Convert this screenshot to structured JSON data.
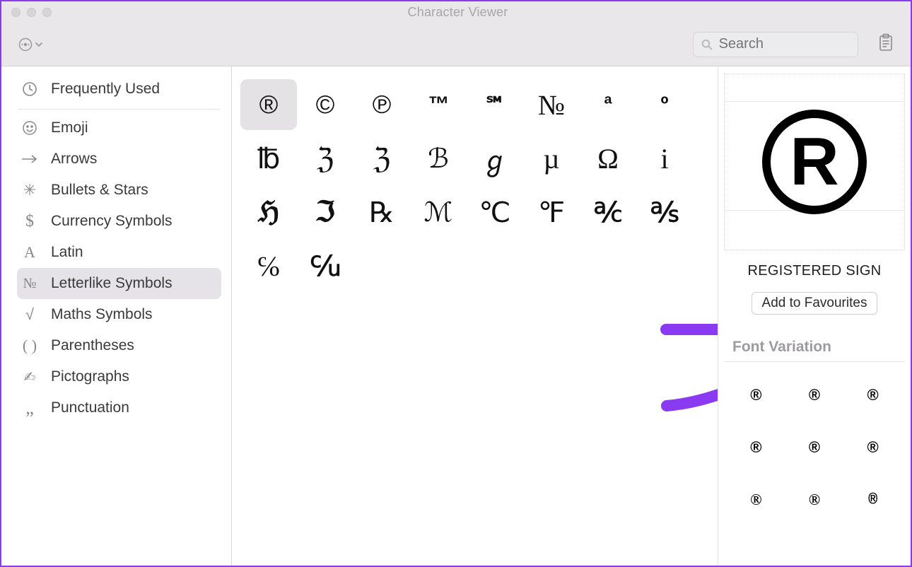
{
  "window": {
    "title": "Character Viewer"
  },
  "search": {
    "placeholder": "Search"
  },
  "sidebar": {
    "items": [
      {
        "label": "Frequently Used",
        "icon": "clock-icon"
      },
      {
        "label": "Emoji",
        "icon": "emoji-icon"
      },
      {
        "label": "Arrows",
        "icon": "arrow-right-icon"
      },
      {
        "label": "Bullets & Stars",
        "icon": "sparkle-icon"
      },
      {
        "label": "Currency Symbols",
        "icon": "dollar-icon"
      },
      {
        "label": "Latin",
        "icon": "letter-a-icon"
      },
      {
        "label": "Letterlike Symbols",
        "icon": "numero-icon",
        "selected": true
      },
      {
        "label": "Maths Symbols",
        "icon": "sqrt-icon"
      },
      {
        "label": "Parentheses",
        "icon": "parens-icon"
      },
      {
        "label": "Pictographs",
        "icon": "writing-hand-icon"
      },
      {
        "label": "Punctuation",
        "icon": "comma-icon"
      }
    ]
  },
  "grid": {
    "selected_index": 0,
    "chars": [
      "®",
      "©",
      "℗",
      "™",
      "℠",
      "№",
      "ª",
      "º",
      "℔",
      "ℨ",
      "ℨ",
      "ℬ",
      "ℊ",
      "µ",
      "Ω",
      "i",
      "ℌ",
      "ℑ",
      "℞",
      "ℳ",
      "℃",
      "℉",
      "℀",
      "℁",
      "℅",
      "℆"
    ]
  },
  "inspector": {
    "glyph": "®",
    "name": "REGISTERED SIGN",
    "add_fav_label": "Add to Favourites",
    "variation_header": "Font Variation",
    "variations": [
      "®",
      "®",
      "®",
      "®",
      "®",
      "®",
      "®",
      "®",
      "®"
    ]
  }
}
